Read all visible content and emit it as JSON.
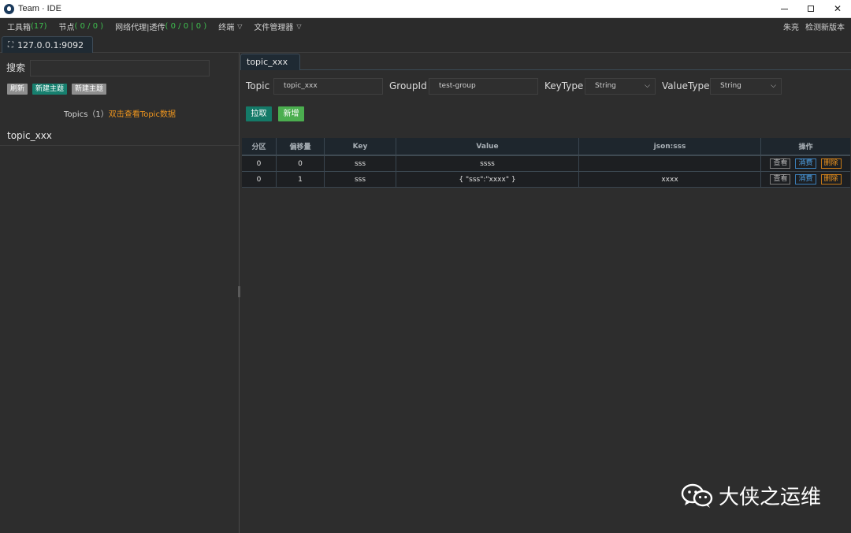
{
  "window": {
    "title": "Team · IDE"
  },
  "menubar": {
    "toolbox": {
      "label": "工具箱",
      "count": "(17)"
    },
    "nodes": {
      "label": "节点",
      "count": "( 0 / 0 )"
    },
    "proxy": {
      "label": "网络代理|透传",
      "count": "( 0 / 0 | 0 )"
    },
    "terminal": {
      "label": "终端"
    },
    "file_manager": {
      "label": "文件管理器"
    },
    "user": "朱亮",
    "check_update": "检测新版本"
  },
  "server_tab": {
    "label": "127.0.0.1:9092"
  },
  "left": {
    "search_label": "搜索",
    "search_value": "",
    "buttons": {
      "refresh": "刷新",
      "new_topic_1": "新建主题",
      "new_topic_2": "新建主题"
    },
    "topics_label": "Topics",
    "topics_count": "（1）",
    "topics_hint": "双击查看Topic数据",
    "topics": [
      "topic_xxx"
    ]
  },
  "right": {
    "tab": "topic_xxx",
    "form": {
      "topic_label": "Topic",
      "topic_value": "topic_xxx",
      "groupid_label": "GroupId",
      "groupid_value": "test-group",
      "keytype_label": "KeyType",
      "keytype_value": "String",
      "valuetype_label": "ValueType",
      "valuetype_value": "String"
    },
    "actions": {
      "pull": "拉取",
      "add": "新增"
    },
    "table": {
      "headers": [
        "分区",
        "偏移量",
        "Key",
        "Value",
        "json:sss",
        "操作"
      ],
      "rows": [
        {
          "partition": "0",
          "offset": "0",
          "key": "sss",
          "value": "ssss",
          "json_sss": ""
        },
        {
          "partition": "0",
          "offset": "1",
          "key": "sss",
          "value": "{ \"sss\":\"xxxx\" }",
          "json_sss": "xxxx"
        }
      ],
      "ops": {
        "view": "查看",
        "consume": "消费",
        "delete": "删除"
      }
    }
  },
  "watermark": {
    "text": "大侠之运维"
  }
}
